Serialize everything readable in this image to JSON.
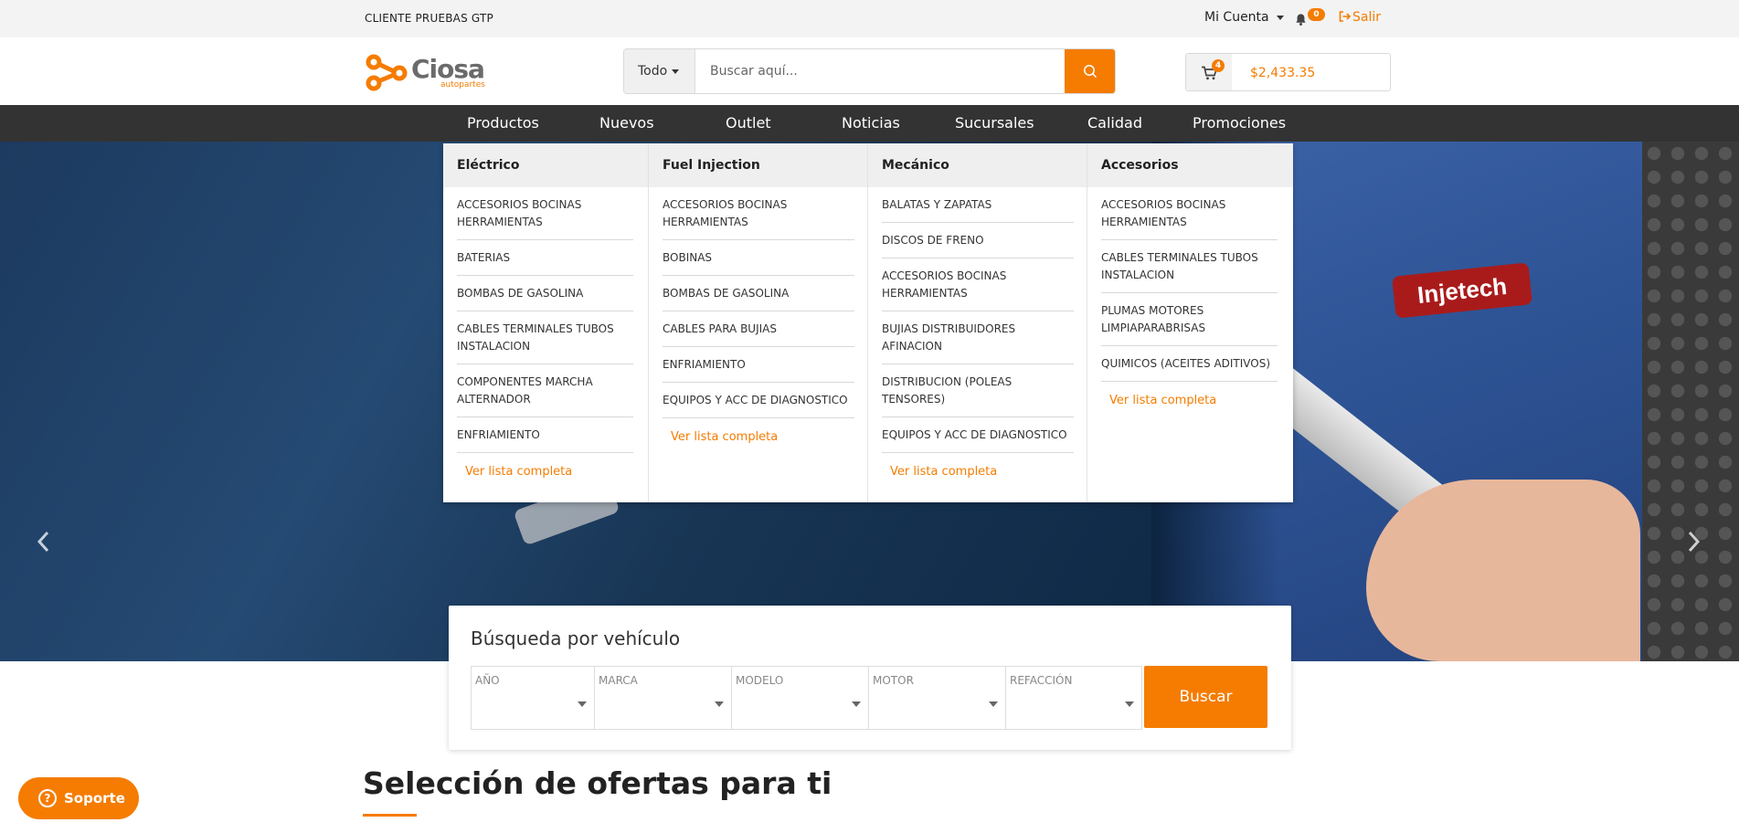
{
  "topbar": {
    "client_name": "CLIENTE PRUEBAS GTP",
    "account_label": "Mi Cuenta",
    "notifications_count": "0",
    "logout_label": "Salir"
  },
  "header": {
    "logo_text": "Ciosa",
    "logo_sub": "autopartes",
    "search": {
      "category": "Todo",
      "placeholder": "Buscar aquí..."
    },
    "cart": {
      "count": "4",
      "total": "$2,433.35"
    }
  },
  "nav": {
    "items": [
      "Productos",
      "Nuevos",
      "Outlet",
      "Noticias",
      "Sucursales",
      "Calidad",
      "Promociones"
    ]
  },
  "hero": {
    "brand": "Injetech"
  },
  "mega_menu": {
    "columns": [
      {
        "title": "Eléctrico",
        "items": [
          "ACCESORIOS BOCINAS HERRAMIENTAS",
          "BATERIAS",
          "BOMBAS DE GASOLINA",
          "CABLES TERMINALES TUBOS INSTALACION",
          "COMPONENTES MARCHA ALTERNADOR",
          "ENFRIAMIENTO"
        ],
        "link": "Ver lista completa"
      },
      {
        "title": "Fuel Injection",
        "items": [
          "ACCESORIOS BOCINAS HERRAMIENTAS",
          "BOBINAS",
          "BOMBAS DE GASOLINA",
          "CABLES PARA BUJIAS",
          "ENFRIAMIENTO",
          "EQUIPOS Y ACC DE DIAGNOSTICO"
        ],
        "link": "Ver lista completa"
      },
      {
        "title": "Mecánico",
        "items": [
          "BALATAS Y ZAPATAS",
          "DISCOS DE FRENO",
          "ACCESORIOS BOCINAS HERRAMIENTAS",
          "BUJIAS DISTRIBUIDORES AFINACION",
          "DISTRIBUCION (POLEAS TENSORES)",
          "EQUIPOS Y ACC DE DIAGNOSTICO"
        ],
        "link": "Ver lista completa"
      },
      {
        "title": "Accesorios",
        "items": [
          "ACCESORIOS BOCINAS HERRAMIENTAS",
          "CABLES TERMINALES TUBOS INSTALACION",
          "PLUMAS MOTORES LIMPIAPARABRISAS",
          "QUIMICOS (ACEITES ADITIVOS)"
        ],
        "link": "Ver lista completa"
      }
    ]
  },
  "vehicle_search": {
    "title": "Búsqueda por vehículo",
    "fields": [
      "AÑO",
      "MARCA",
      "MODELO",
      "MOTOR",
      "REFACCIÓN"
    ],
    "button": "Buscar"
  },
  "offers": {
    "title": "Selección de ofertas para ti"
  },
  "support": {
    "label": "Soporte"
  },
  "colors": {
    "accent": "#f57c00",
    "nav_bg": "#333333",
    "topbar_bg": "#f3f3f3"
  }
}
